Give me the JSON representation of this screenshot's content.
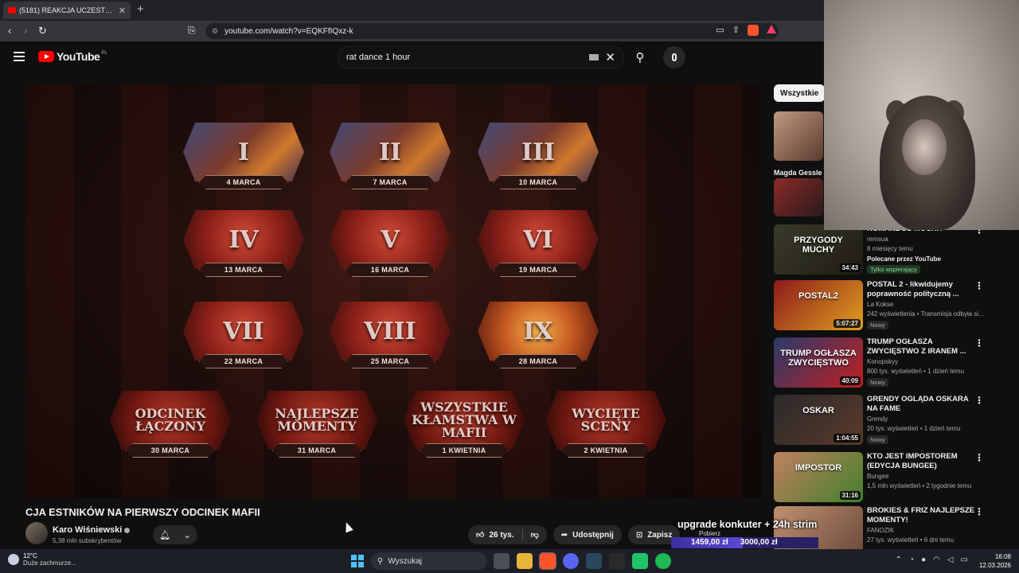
{
  "browser": {
    "tab_title": "(5181) REAKCJA UCZESTNIKÓ",
    "tab_close": "✕",
    "new_tab": "+",
    "url": "youtube.com/watch?v=EQKFfIQxz-k"
  },
  "youtube": {
    "logo_text": "YouTube",
    "country": "PL",
    "search_query": "rat dance 1 hour",
    "clear": "✕"
  },
  "player": {
    "episodes": [
      {
        "label": "I",
        "date": "4 MARCA",
        "style": "photo"
      },
      {
        "label": "II",
        "date": "7 MARCA",
        "style": "photo"
      },
      {
        "label": "III",
        "date": "10 MARCA",
        "style": "photo"
      },
      {
        "label": "IV",
        "date": "13 MARCA",
        "style": "blur"
      },
      {
        "label": "V",
        "date": "16 MARCA",
        "style": "blur"
      },
      {
        "label": "VI",
        "date": "19 MARCA",
        "style": "blur"
      },
      {
        "label": "VII",
        "date": "22 MARCA",
        "style": "blur"
      },
      {
        "label": "VIII",
        "date": "25 MARCA",
        "style": "blur"
      },
      {
        "label": "IX",
        "date": "28 MARCA",
        "style": "gold"
      }
    ],
    "specials": [
      {
        "label": "ODCINEK ŁĄCZONY",
        "date": "30 MARCA"
      },
      {
        "label": "NAJLEPSZE MOMENTY",
        "date": "31 MARCA"
      },
      {
        "label": "WSZYSTKIE KŁAMSTWA W MAFII",
        "date": "1 KWIETNIA"
      },
      {
        "label": "WYCIĘTE SCENY",
        "date": "2 KWIETNIA"
      }
    ]
  },
  "video": {
    "title": "CJA ESTNIKÓW NA PIERWSZY ODCINEK MAFII",
    "channel": "Karo  Wiśniewski",
    "subscribers": "5,38 mln subskrybentów",
    "likes": "26 tys.",
    "share": "Udostępnij",
    "save": "Zapisz",
    "download": "Pobierz"
  },
  "sidebar": {
    "chip": "Wszystkie",
    "partial_label": "Magda Gessle",
    "items": [
      {
        "title": "KOMANDOS MUCHA",
        "channel": "remsua",
        "meta": "8 miesięcy temu",
        "promo": "Polecane przez YouTube",
        "badge": "Tylko wspierający",
        "duration": "34:43",
        "thumb_text": "PRZYGODY MUCHY",
        "colors": [
          "#3a3a2a",
          "#1e1c14"
        ]
      },
      {
        "title": "POSTAL 2 - likwidujemy poprawność polityczną ...",
        "channel": "La Kokse",
        "meta": "242 wyświetlenia • Transmisja odbyła si...",
        "badge": "Nowy",
        "duration": "5:07:27",
        "thumb_text": "POSTAL2",
        "colors": [
          "#8b1a1a",
          "#e0a020"
        ]
      },
      {
        "title": "TRUMP OGŁASZA ZWYCIĘSTWO Z IRANEM ...",
        "channel": "Konopskyy",
        "meta": "800 tys. wyświetleń • 1 dzień temu",
        "badge": "Nowy",
        "duration": "40:09",
        "thumb_text": "TRUMP OGŁASZA ZWYCIĘSTWO",
        "colors": [
          "#2a3a6a",
          "#c02020"
        ]
      },
      {
        "title": "GRENDY OGLĄDA OSKARA NA FAME",
        "channel": "Grendy",
        "meta": "20 tys. wyświetleń • 1 dzień temu",
        "badge": "Nowy",
        "duration": "1:04:55",
        "thumb_text": "OSKAR",
        "colors": [
          "#2a2a2a",
          "#5a3a2a"
        ]
      },
      {
        "title": "KTO JEST IMPOSTOREM (EDYCJA BUNGEE)",
        "channel": "Bungee",
        "meta": "1,5 mln wyświetleń • 2 tygodnie temu",
        "duration": "31:16",
        "thumb_text": "IMPOSTOR",
        "colors": [
          "#c08060",
          "#40802a"
        ]
      },
      {
        "title": "BROKIES & FRIZ NAJLEPSZE MOMENTY!",
        "channel": "FANOZIK",
        "meta": "27 tys. wyświetleń • 6 dni temu",
        "duration": "",
        "thumb_text": "",
        "colors": [
          "#c09070",
          "#6a4a3a"
        ]
      }
    ]
  },
  "overlay": {
    "text": "upgrade konkuter + 24h strim",
    "current": "1459,00 zł",
    "goal": "3000,00 zł",
    "progress": 0.486
  },
  "taskbar": {
    "temperature": "12°C",
    "weather": "Duże zachmurze...",
    "search": "Wyszukaj",
    "time": "16:08",
    "date": "12.03.2026"
  },
  "colors": {
    "youtube_red": "#ff0000",
    "background": "#0f0f0f",
    "accent_windows": "#4cc2ff"
  }
}
